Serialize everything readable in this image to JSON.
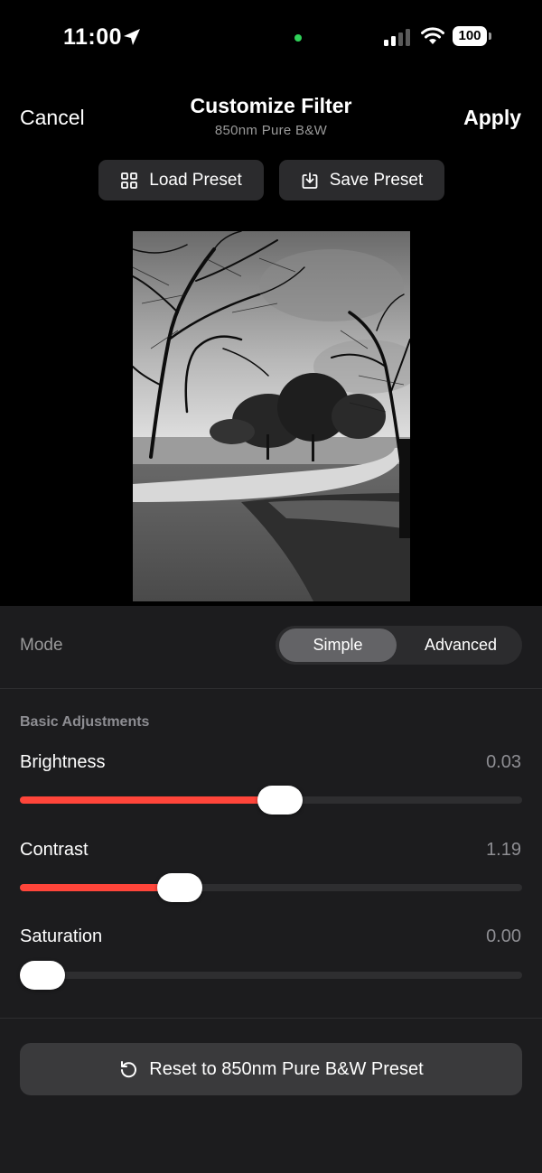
{
  "status_bar": {
    "time": "11:00",
    "battery": "100",
    "icons": [
      "location-arrow-icon",
      "camera-in-use-dot",
      "cellular-signal-icon",
      "wifi-icon",
      "battery-icon"
    ],
    "camera_dot_color": "#2fd158"
  },
  "header": {
    "cancel_label": "Cancel",
    "title": "Customize Filter",
    "subtitle": "850nm Pure B&W",
    "apply_label": "Apply"
  },
  "presets": {
    "load_label": "Load Preset",
    "load_icon": "grid-icon",
    "save_label": "Save Preset",
    "save_icon": "download-tray-icon"
  },
  "mode": {
    "label": "Mode",
    "options": [
      "Simple",
      "Advanced"
    ],
    "selected": "Simple"
  },
  "adjustments": {
    "section_title": "Basic Adjustments",
    "accent_color": "#ff453a",
    "sliders": [
      {
        "label": "Brightness",
        "value": "0.03",
        "fraction": 0.52
      },
      {
        "label": "Contrast",
        "value": "1.19",
        "fraction": 0.3
      },
      {
        "label": "Saturation",
        "value": "0.00",
        "fraction": 0.0
      }
    ]
  },
  "reset": {
    "label": "Reset to 850nm Pure B&W Preset",
    "icon": "rotate-ccw-icon"
  }
}
